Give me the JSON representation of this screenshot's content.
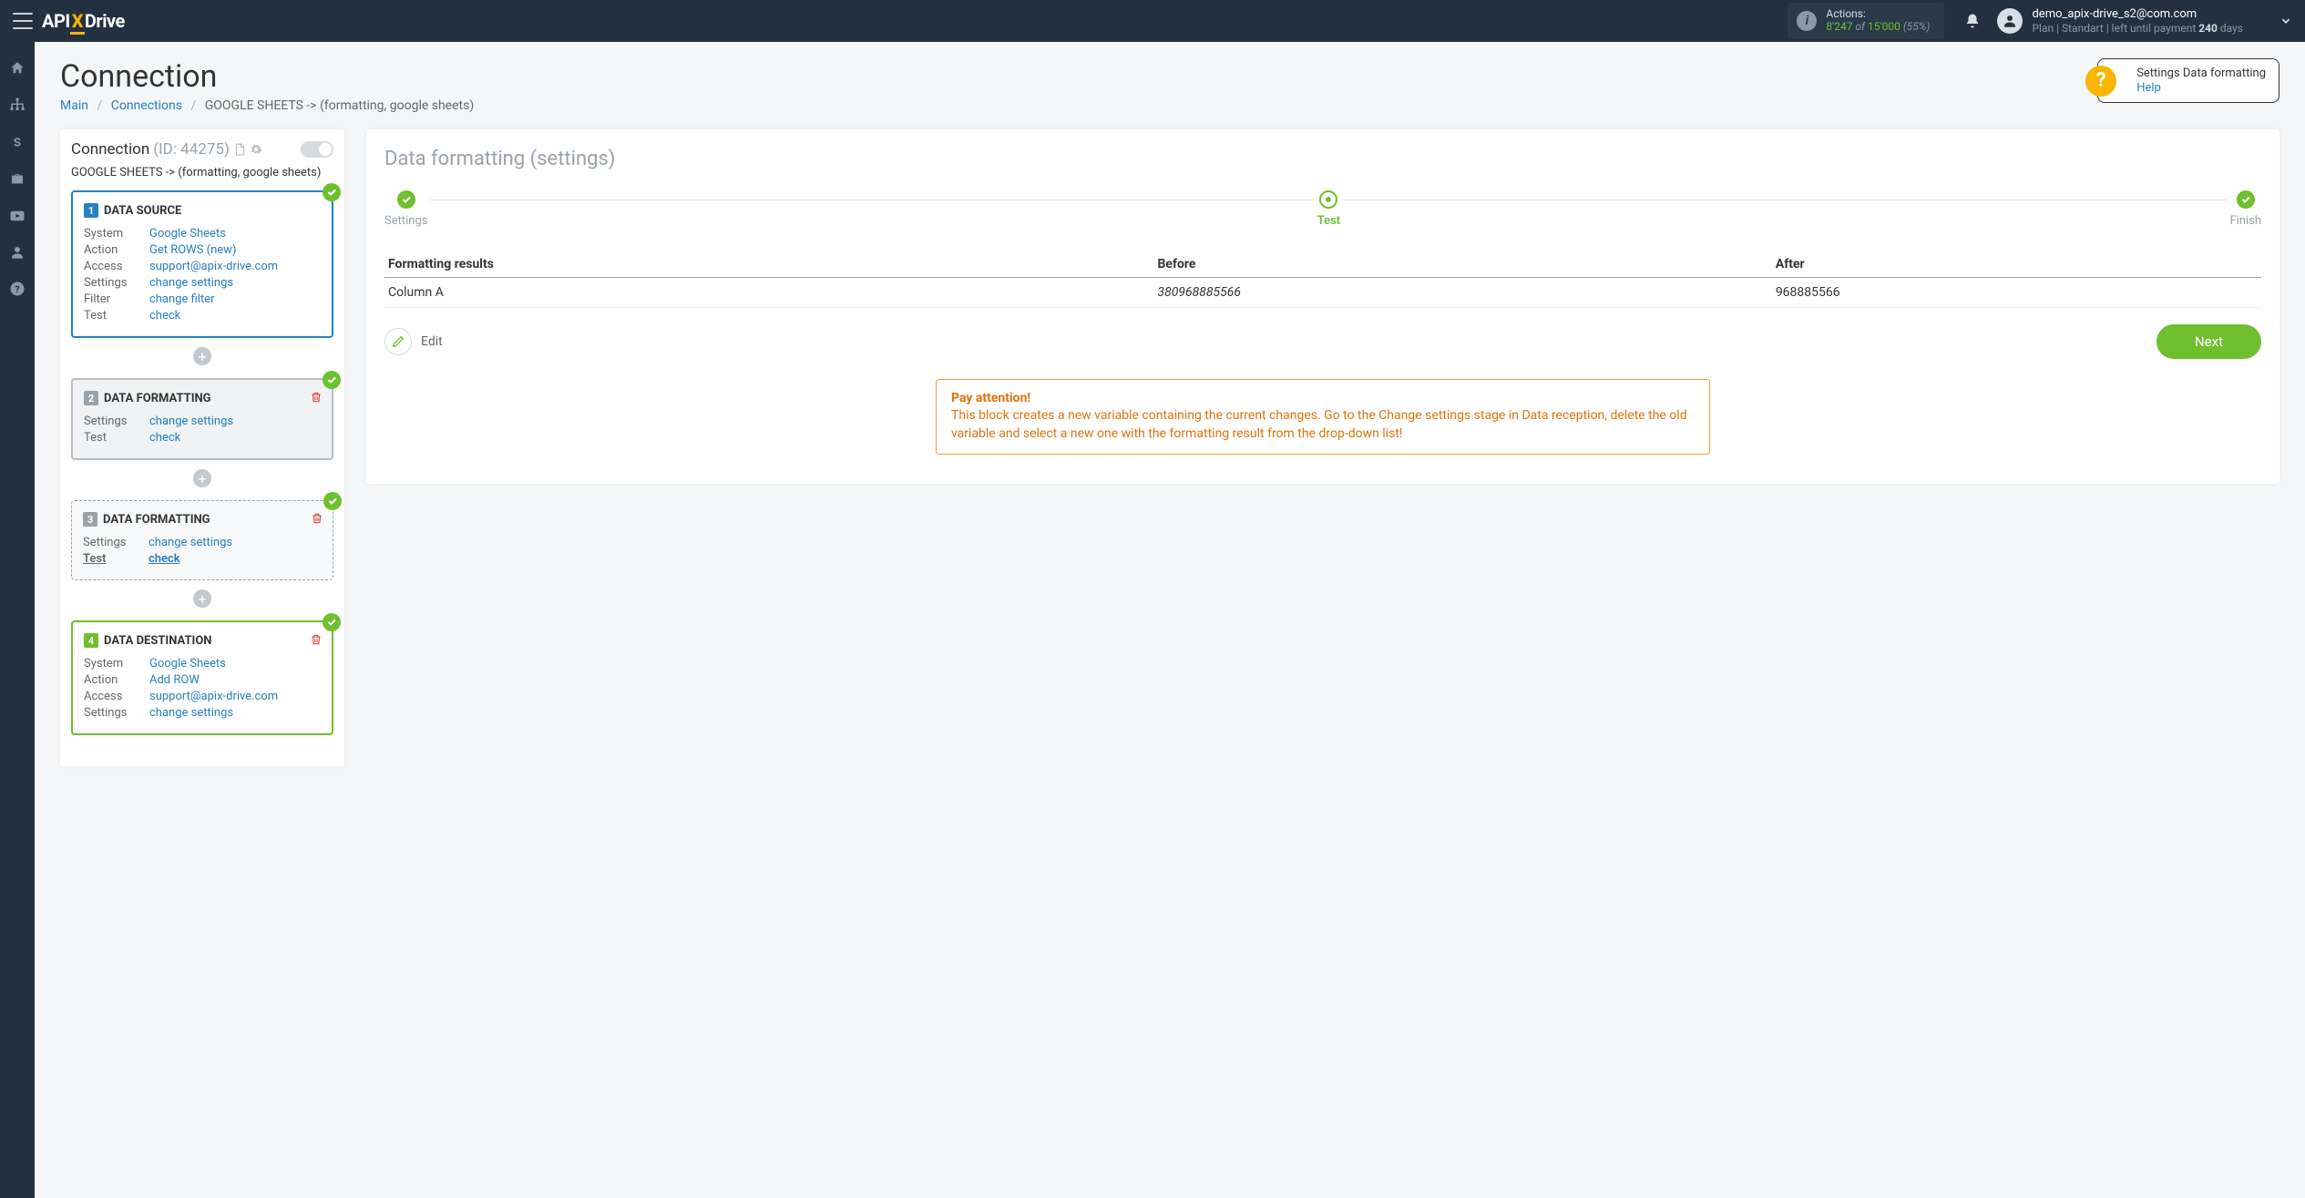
{
  "topbar": {
    "logo_left": "API",
    "logo_right": "Drive",
    "actions_label": "Actions:",
    "actions_used": "8'247",
    "actions_of": " of ",
    "actions_total": "15'000",
    "actions_pct": " (55%)",
    "email": "demo_apix-drive_s2@com.com",
    "plan_prefix": "Plan  | Standart |  left until payment ",
    "plan_days": "240",
    "plan_suffix": " days"
  },
  "page": {
    "title": "Connection",
    "crumb_main": "Main",
    "crumb_connections": "Connections",
    "crumb_current": "GOOGLE SHEETS -> (formatting, google sheets)",
    "help_title": "Settings Data formatting",
    "help_link": "Help"
  },
  "conn": {
    "head": "Connection",
    "id": " (ID: 44275) ",
    "sub": "GOOGLE SHEETS -> (formatting, google sheets)",
    "add": "+",
    "cards": {
      "src": {
        "title": "DATA SOURCE",
        "num": "1",
        "rows": [
          {
            "k": "System",
            "v": "Google Sheets"
          },
          {
            "k": "Action",
            "v": "Get ROWS (new)"
          },
          {
            "k": "Access",
            "v": "support@apix-drive.com"
          },
          {
            "k": "Settings",
            "v": "change settings"
          },
          {
            "k": "Filter",
            "v": "change filter"
          },
          {
            "k": "Test",
            "v": "check"
          }
        ]
      },
      "fmt2": {
        "title": "DATA FORMATTING",
        "num": "2",
        "rows": [
          {
            "k": "Settings",
            "v": "change settings"
          },
          {
            "k": "Test",
            "v": "check"
          }
        ]
      },
      "fmt3": {
        "title": "DATA FORMATTING",
        "num": "3",
        "rows": [
          {
            "k": "Settings",
            "v": "change settings"
          },
          {
            "k": "Test",
            "v": "check",
            "u": true
          }
        ]
      },
      "dst": {
        "title": "DATA DESTINATION",
        "num": "4",
        "rows": [
          {
            "k": "System",
            "v": "Google Sheets"
          },
          {
            "k": "Action",
            "v": "Add ROW"
          },
          {
            "k": "Access",
            "v": "support@apix-drive.com"
          },
          {
            "k": "Settings",
            "v": "change settings"
          }
        ]
      }
    }
  },
  "main": {
    "title": "Data formatting",
    "title_sub": " (settings)",
    "steps": {
      "s1": "Settings",
      "s2": "Test",
      "s3": "Finish"
    },
    "table": {
      "h1": "Formatting results",
      "h2": "Before",
      "h3": "After",
      "r1c1": "Column A",
      "r1c2": "380968885566",
      "r1c3": "968885566"
    },
    "edit": "Edit",
    "next": "Next",
    "alert_title": "Pay attention!",
    "alert_text": "This block creates a new variable containing the current changes. Go to the Change settings stage in Data reception, delete the old variable and select a new one with the formatting result from the drop-down list!"
  }
}
